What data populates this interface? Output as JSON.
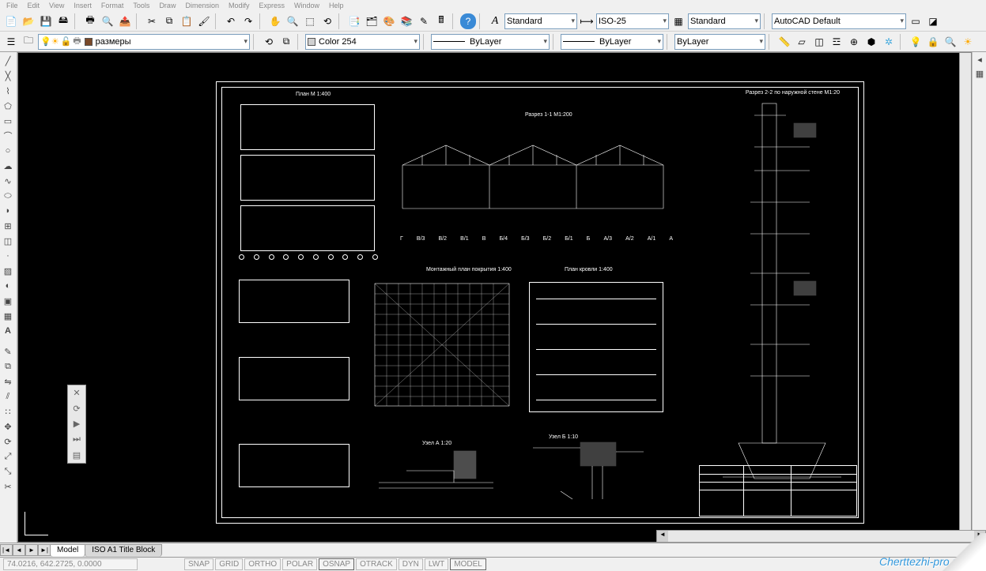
{
  "menu": {
    "items": [
      "File",
      "Edit",
      "View",
      "Insert",
      "Format",
      "Tools",
      "Draw",
      "Dimension",
      "Modify",
      "Express",
      "Window",
      "Help"
    ]
  },
  "toolbar1": {
    "text_style": "Standard",
    "dim_style": "ISO-25",
    "table_style": "Standard",
    "plot_style": "AutoCAD Default"
  },
  "toolbar2": {
    "layer": "размеры",
    "color": "Color 254",
    "linetype": "ByLayer",
    "lineweight": "ByLayer",
    "plotstyle": "ByLayer"
  },
  "tabs": {
    "model": "Model",
    "layout1": "ISO A1 Title Block"
  },
  "status": {
    "coords": "74.0216, 642.2725, 0.0000",
    "btns": [
      "SNAP",
      "GRID",
      "ORTHO",
      "POLAR",
      "OSNAP",
      "OTRACK",
      "DYN",
      "LWT",
      "MODEL"
    ]
  },
  "drawing": {
    "plan": "План М 1:400",
    "section1": "Разрез 1-1 M1:200",
    "section2": "Разрез 2-2 по наружной стене  М1:20",
    "roof_assembly": "Монтажный план покрытия 1:400",
    "roof_plan": "План кровли 1:400",
    "node_a": "Узел А 1:20",
    "node_b": "Узел Б 1:10",
    "axis_labels": [
      "Г",
      "В/3",
      "В/2",
      "В/1",
      "В",
      "Б/4",
      "Б/3",
      "Б/2",
      "Б/1",
      "Б",
      "А/3",
      "А/2",
      "А/1",
      "А"
    ]
  },
  "watermark": "Cherttezhi-pro.ru"
}
